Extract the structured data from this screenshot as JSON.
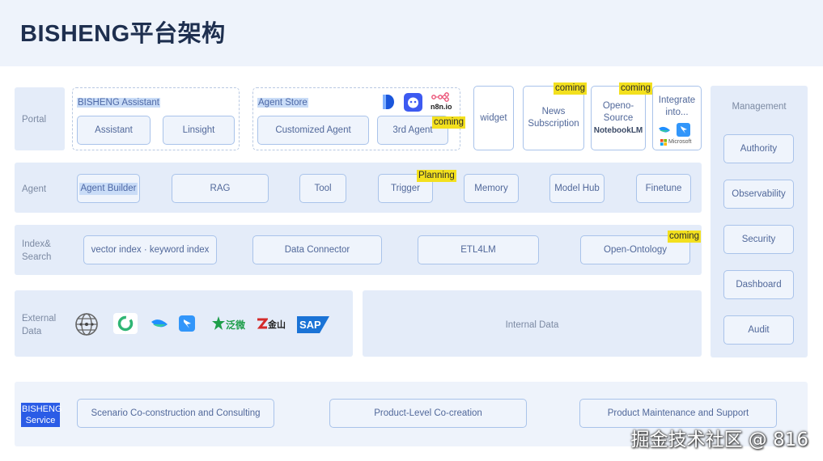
{
  "title": "BISHENG平台架构",
  "colors": {
    "accent": "#2b5ce6",
    "tag": "#f3e01e",
    "border": "#a9c3ea",
    "band": "#e4ecf9"
  },
  "layers": {
    "portal": {
      "label": "Portal",
      "assistant_group": {
        "label": "BISHENG Assistant",
        "items": [
          "Assistant",
          "Linsight"
        ]
      },
      "agent_store": {
        "label": "Agent Store",
        "items": [
          "Customized Agent",
          "3rd Agent"
        ],
        "tag": "coming",
        "logo_text": "n8n.io"
      },
      "widget": "widget",
      "news": {
        "label": "News Subscription",
        "tag": "coming"
      },
      "openo": {
        "line1": "Openo-",
        "line2": "Source",
        "line3": "NotebookLM",
        "tag": "coming"
      },
      "integrate": {
        "label": "Integrate into...",
        "logo_text": "Microsoft"
      }
    },
    "agent": {
      "label": "Agent",
      "items": [
        "Agent Builder",
        "RAG",
        "Tool",
        "Trigger",
        "Memory",
        "Model Hub",
        "Finetune"
      ],
      "trigger_tag": "Planning"
    },
    "index": {
      "label": "Index& Search",
      "items": [
        "vector index · keyword index",
        "Data Connector",
        "ETL4LM",
        "Open-Ontology"
      ],
      "ontology_tag": "coming"
    },
    "external": {
      "label": "External Data",
      "logos": [
        "globe-network-icon",
        "green-ring-logo",
        "bird-logo",
        "lark-logo",
        "fanwei-logo",
        "kingdee-logo",
        "sap-logo"
      ],
      "logo_text": {
        "fanwei": "泛微",
        "kingdee": "金山",
        "sap": "SAP"
      }
    },
    "internal": {
      "label": "Internal Data"
    },
    "management": {
      "label": "Management",
      "items": [
        "Authority",
        "Observability",
        "Security",
        "Dashboard",
        "Audit"
      ]
    },
    "service": {
      "badge": "BISHENG Service",
      "items": [
        "Scenario Co-construction and Consulting",
        "Product-Level Co-creation",
        "Product Maintenance and Support"
      ]
    }
  },
  "watermark": "掘金技术社区 @ 816"
}
